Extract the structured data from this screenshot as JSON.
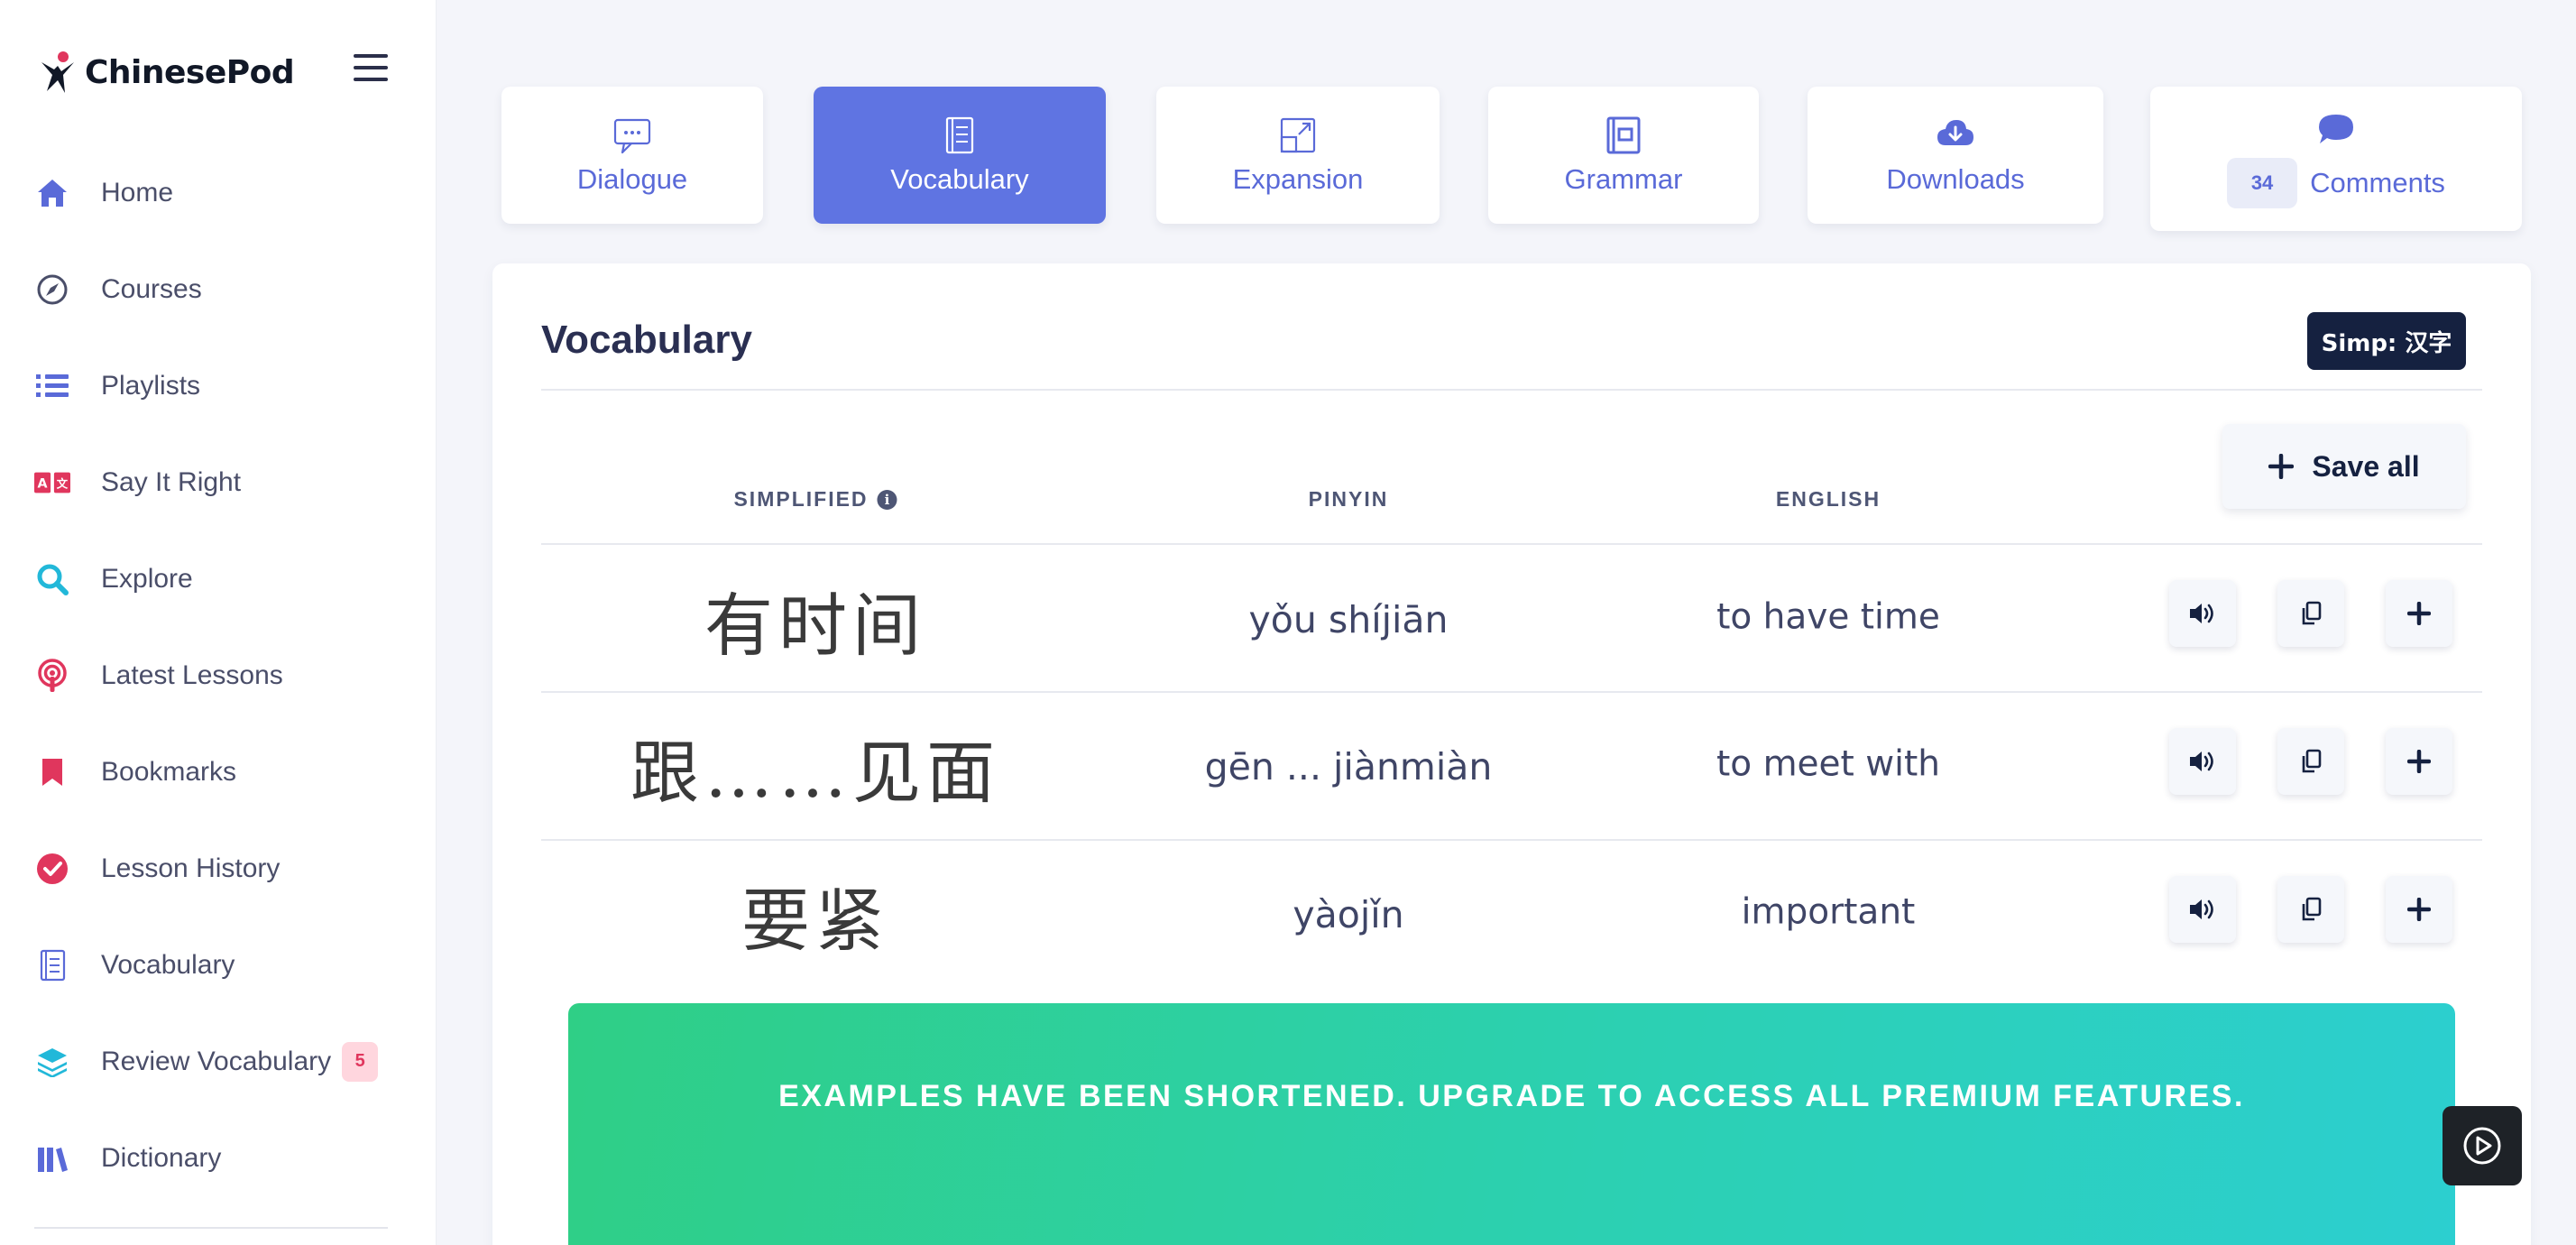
{
  "app": {
    "name": "ChinesePod"
  },
  "sidebar": {
    "items": [
      {
        "label": "Home",
        "icon": "home-icon",
        "color": "#5a6ad8"
      },
      {
        "label": "Courses",
        "icon": "compass-icon",
        "color": "#4a4e69"
      },
      {
        "label": "Playlists",
        "icon": "list-icon",
        "color": "#5a6ad8"
      },
      {
        "label": "Say It Right",
        "icon": "translate-icon",
        "color": "#e0365d"
      },
      {
        "label": "Explore",
        "icon": "search-icon",
        "color": "#22b8d9"
      },
      {
        "label": "Latest Lessons",
        "icon": "podcast-icon",
        "color": "#e0365d"
      },
      {
        "label": "Bookmarks",
        "icon": "bookmark-icon",
        "color": "#e0365d"
      },
      {
        "label": "Lesson History",
        "icon": "check-circle-icon",
        "color": "#e0365d"
      },
      {
        "label": "Vocabulary",
        "icon": "notebook-icon",
        "color": "#5a6ad8"
      },
      {
        "label": "Review Vocabulary",
        "icon": "layers-icon",
        "color": "#22b8d9",
        "badge": "5"
      },
      {
        "label": "Dictionary",
        "icon": "books-icon",
        "color": "#5a6ad8"
      }
    ]
  },
  "tabs": [
    {
      "label": "Dialogue",
      "icon": "chat-bubble-icon",
      "active": false
    },
    {
      "label": "Vocabulary",
      "icon": "notebook-icon",
      "active": true
    },
    {
      "label": "Expansion",
      "icon": "expand-icon",
      "active": false
    },
    {
      "label": "Grammar",
      "icon": "grammar-book-icon",
      "active": false
    },
    {
      "label": "Downloads",
      "icon": "cloud-download-icon",
      "active": false
    },
    {
      "label": "Comments",
      "icon": "comment-icon",
      "active": false,
      "count": "34"
    }
  ],
  "vocabulary": {
    "title": "Vocabulary",
    "script_toggle": "Simp: 汉字",
    "save_all": "Save all",
    "columns": {
      "simplified": "SIMPLIFIED",
      "pinyin": "PINYIN",
      "english": "ENGLISH"
    },
    "rows": [
      {
        "simplified": "有时间",
        "pinyin": "yǒu shíjiān",
        "english": "to have time"
      },
      {
        "simplified": "跟……见面",
        "pinyin": "gēn ... jiànmiàn",
        "english": "to meet with"
      },
      {
        "simplified": "要紧",
        "pinyin": "yàojǐn",
        "english": "important"
      }
    ]
  },
  "banner": {
    "text": "EXAMPLES HAVE BEEN SHORTENED. UPGRADE TO ACCESS ALL PREMIUM FEATURES."
  },
  "colors": {
    "accent": "#5f74e2",
    "dark_navy": "#152140",
    "banner_start": "#2fcf86",
    "banner_end": "#2ccfd0",
    "badge_bg": "#ffd6de"
  }
}
